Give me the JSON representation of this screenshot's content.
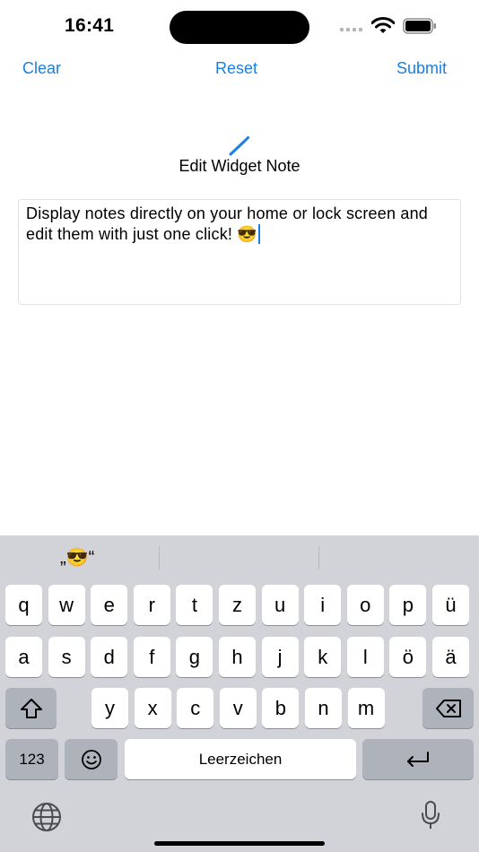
{
  "status_bar": {
    "time": "16:41"
  },
  "nav": {
    "clear": "Clear",
    "reset": "Reset",
    "submit": "Submit"
  },
  "editor": {
    "title": "Edit Widget Note",
    "icon": "pencil-icon",
    "text": "Display notes directly on your home or lock screen and edit them with just one click! 😎"
  },
  "keyboard": {
    "suggestion": "„😎“",
    "row1": [
      "q",
      "w",
      "e",
      "r",
      "t",
      "z",
      "u",
      "i",
      "o",
      "p",
      "ü"
    ],
    "row2": [
      "a",
      "s",
      "d",
      "f",
      "g",
      "h",
      "j",
      "k",
      "l",
      "ö",
      "ä"
    ],
    "row3": [
      "y",
      "x",
      "c",
      "v",
      "b",
      "n",
      "m"
    ],
    "numbers_label": "123",
    "space_label": "Leerzeichen"
  },
  "colors": {
    "accent": "#1a7fe0",
    "keyboard_bg": "#d1d3d9",
    "key_dark": "#aeb2bb"
  }
}
